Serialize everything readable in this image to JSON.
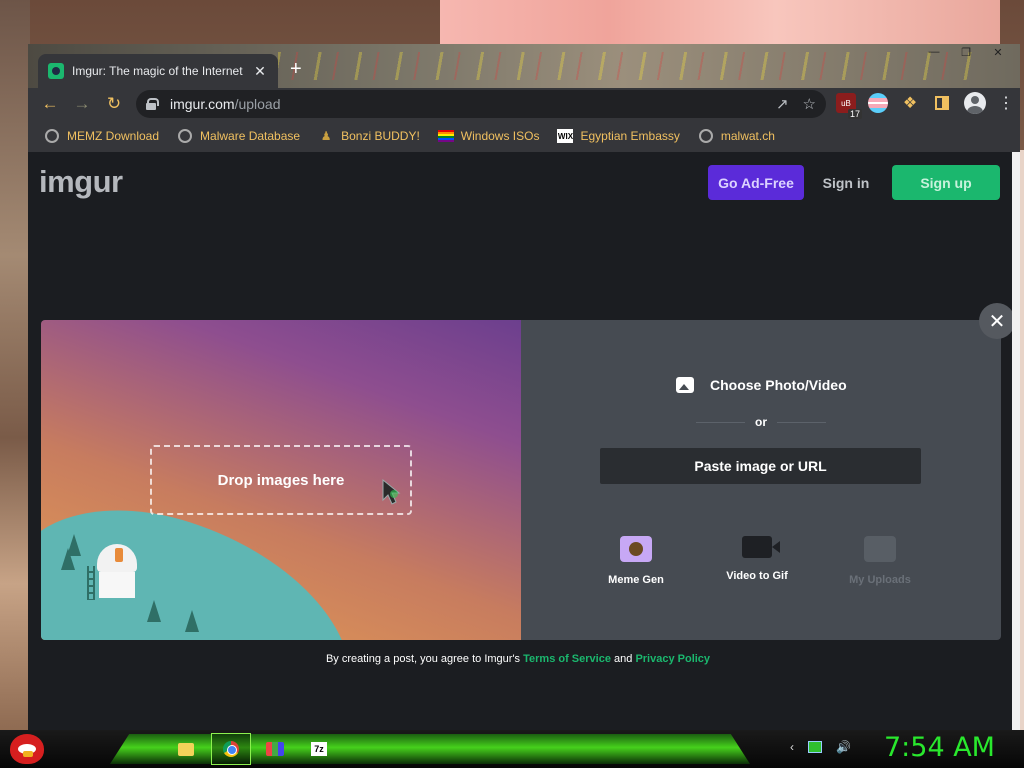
{
  "browser": {
    "tab_title": "Imgur: The magic of the Internet",
    "tab_close": "✕",
    "new_tab": "+",
    "window_controls": {
      "minimize": "—",
      "maximize": "❐",
      "close": "✕"
    },
    "url_host": "imgur.com",
    "url_path": "/upload",
    "extension_badge": "17",
    "extension_label": "uB"
  },
  "bookmarks": [
    {
      "label": "MEMZ Download",
      "icon": "globe-icon"
    },
    {
      "label": "Malware Database",
      "icon": "globe-icon"
    },
    {
      "label": "Bonzi BUDDY!",
      "icon": "bonzi-icon"
    },
    {
      "label": "Windows ISOs",
      "icon": "rainbow-flag-icon"
    },
    {
      "label": "Egyptian Embassy",
      "icon": "wix-icon"
    },
    {
      "label": "malwat.ch",
      "icon": "globe-icon"
    }
  ],
  "bookmark_icon_text": {
    "wix": "WIX"
  },
  "header": {
    "logo": "imgur",
    "ad_free": "Go Ad-Free",
    "sign_in": "Sign in",
    "sign_up": "Sign up"
  },
  "upload": {
    "drop_label": "Drop images here",
    "choose_label": "Choose Photo/Video",
    "or_label": "or",
    "paste_label": "Paste image or URL",
    "tools": [
      {
        "label": "Meme Gen",
        "icon": "meme-gen-icon",
        "enabled": true
      },
      {
        "label": "Video to Gif",
        "icon": "video-camera-icon",
        "enabled": true
      },
      {
        "label": "My Uploads",
        "icon": "uploads-icon",
        "enabled": false
      }
    ],
    "close": "✕"
  },
  "terms": {
    "prefix": "By creating a post, you agree to Imgur's",
    "tos": "Terms of Service",
    "and": "and",
    "privacy": "Privacy Policy"
  },
  "taskbar": {
    "zip_label": "7z",
    "clock": "7:54 AM"
  },
  "colors": {
    "brand_green": "#1bb76e",
    "ad_free_purple": "#5b2bd9",
    "bookmark_text": "#f0c060",
    "clock_green": "#29e82d"
  }
}
